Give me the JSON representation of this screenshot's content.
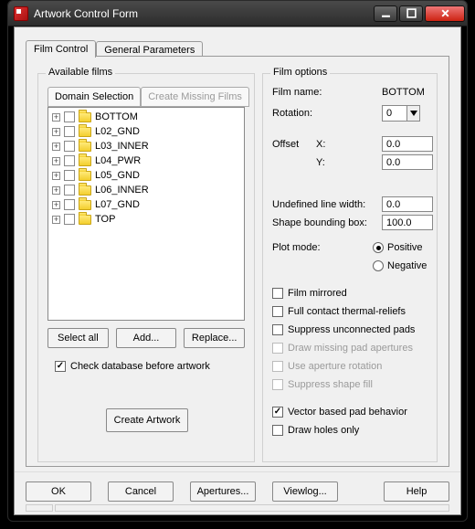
{
  "window": {
    "title": "Artwork Control Form"
  },
  "tabs": {
    "film_control": "Film Control",
    "general_params": "General Parameters"
  },
  "available_films": {
    "legend": "Available films",
    "subtabs": {
      "domain_selection": "Domain Selection",
      "create_missing": "Create Missing Films"
    },
    "items": [
      {
        "label": "BOTTOM"
      },
      {
        "label": "L02_GND"
      },
      {
        "label": "L03_INNER"
      },
      {
        "label": "L04_PWR"
      },
      {
        "label": "L05_GND"
      },
      {
        "label": "L06_INNER"
      },
      {
        "label": "L07_GND"
      },
      {
        "label": "TOP"
      }
    ],
    "buttons": {
      "select_all": "Select all",
      "add": "Add...",
      "replace": "Replace..."
    },
    "check_db": "Check database before artwork",
    "create_artwork": "Create Artwork"
  },
  "film_options": {
    "legend": "Film options",
    "film_name_label": "Film name:",
    "film_name_value": "BOTTOM",
    "rotation_label": "Rotation:",
    "rotation_value": "0",
    "offset_label": "Offset",
    "offset_x_label": "X:",
    "offset_x_value": "0.0",
    "offset_y_label": "Y:",
    "offset_y_value": "0.0",
    "undef_line_label": "Undefined line width:",
    "undef_line_value": "0.0",
    "shape_bb_label": "Shape bounding box:",
    "shape_bb_value": "100.0",
    "plot_mode_label": "Plot mode:",
    "positive": "Positive",
    "negative": "Negative",
    "cb_mirrored": "Film mirrored",
    "cb_thermal": "Full contact thermal-reliefs",
    "cb_suppress_pads": "Suppress unconnected pads",
    "cb_draw_missing": "Draw missing pad apertures",
    "cb_aperture_rot": "Use aperture rotation",
    "cb_suppress_fill": "Suppress shape fill",
    "cb_vector": "Vector based pad behavior",
    "cb_holes": "Draw holes only"
  },
  "bottom_buttons": {
    "ok": "OK",
    "cancel": "Cancel",
    "apertures": "Apertures...",
    "viewlog": "Viewlog...",
    "help": "Help"
  }
}
